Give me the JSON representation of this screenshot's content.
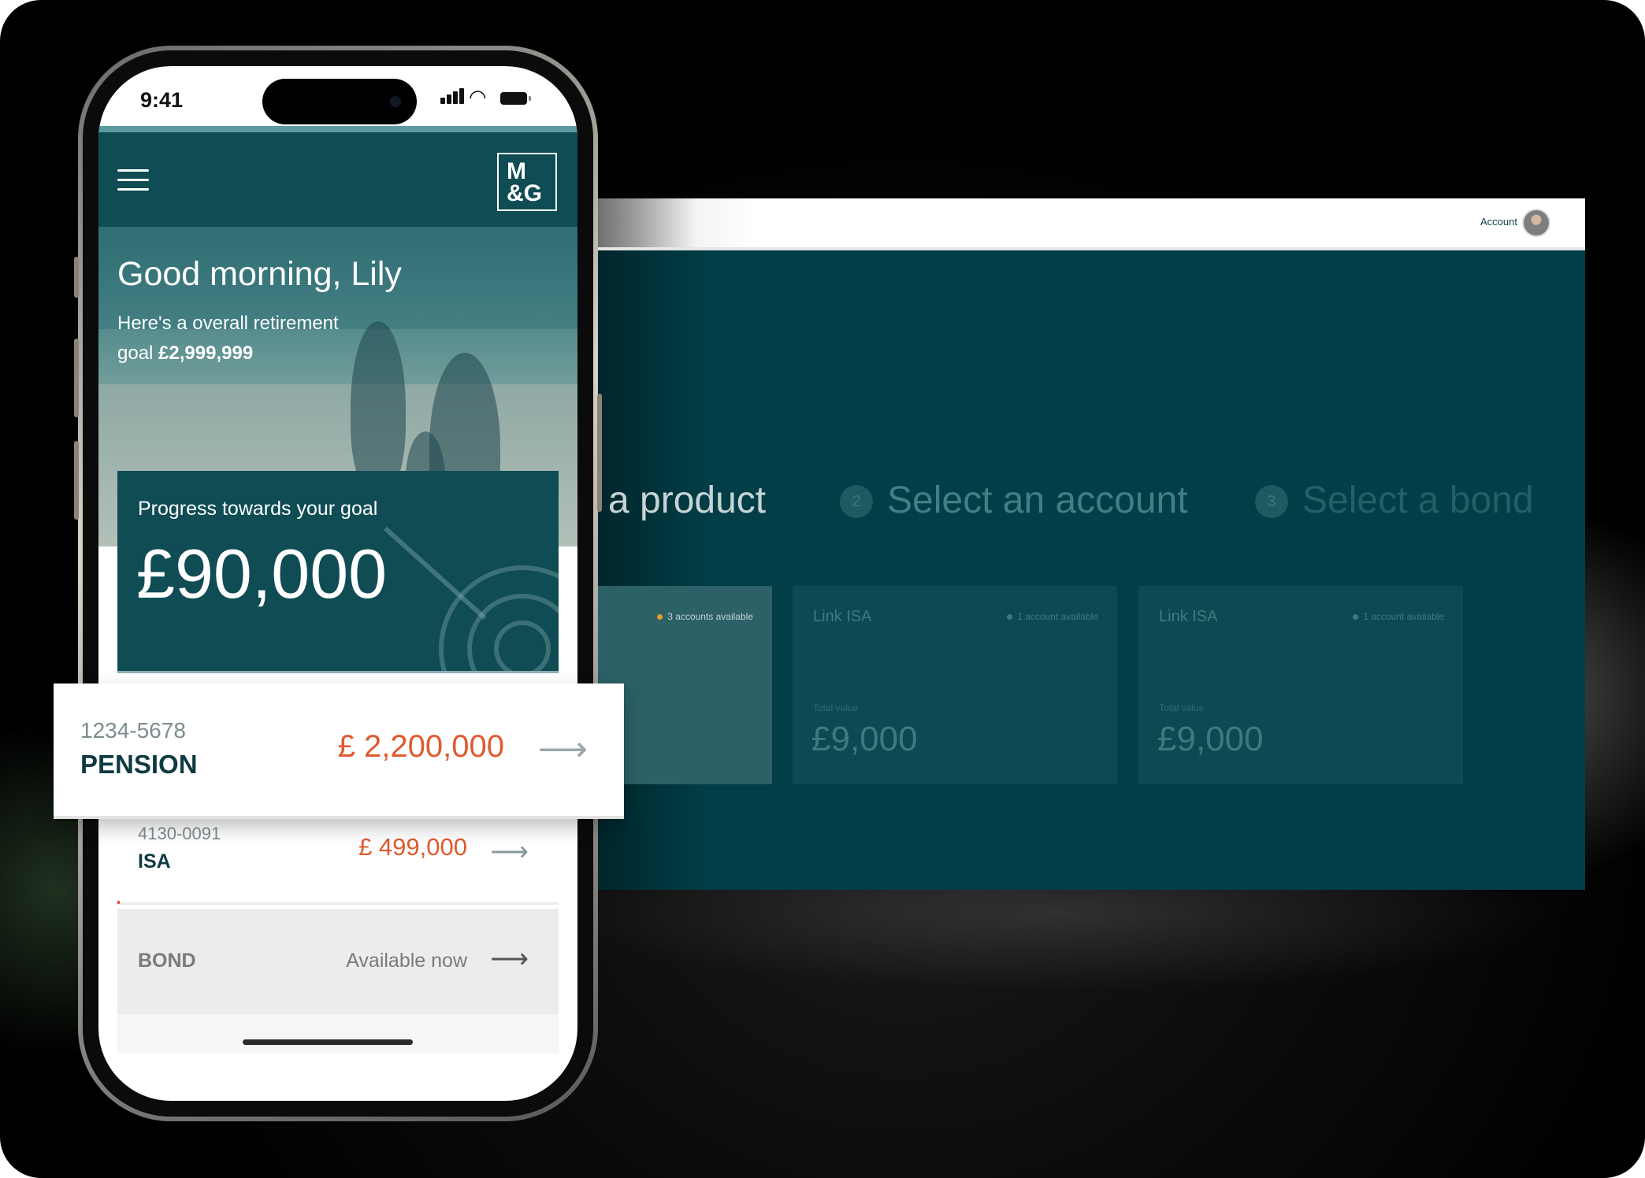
{
  "phone": {
    "status_time": "9:41",
    "logo_line1": "M",
    "logo_line2": "&G",
    "greeting": "Good morning, Lily",
    "goal_text": "Here's a overall retirement goal",
    "goal_value": "£2,999,999",
    "progress_label": "Progress towards your goal",
    "progress_value": "£90,000",
    "accounts": [
      {
        "number": "1234-5678",
        "type": "PENSION",
        "value": "£ 2,200,000"
      },
      {
        "number": "4130-0091",
        "type": "ISA",
        "value": "£ 499,000"
      },
      {
        "type": "BOND",
        "status": "Available now"
      }
    ]
  },
  "desktop": {
    "account_label": "Account",
    "steps": [
      {
        "label": "a product"
      },
      {
        "number": "2",
        "label": "Select an account"
      },
      {
        "number": "3",
        "label": "Select a bond"
      }
    ],
    "cards": [
      {
        "name": "",
        "availability": "3 accounts available",
        "total_label": "",
        "total": ""
      },
      {
        "name": "Link ISA",
        "availability": "1 account available",
        "total_label": "Total value",
        "total": "£9,000"
      },
      {
        "name": "Link ISA",
        "availability": "1 account available",
        "total_label": "Total value",
        "total": "£9,000"
      }
    ]
  },
  "icons": {
    "menu": "hamburger-icon",
    "arrow": "arrow-right-icon",
    "wifi": "wifi-icon",
    "battery": "battery-icon",
    "signal": "signal-icon",
    "target": "target-arrow-icon"
  },
  "colors": {
    "brand_teal": "#0f4c54",
    "accent_orange": "#e05a2e",
    "status_dot": "#e69a2c"
  }
}
